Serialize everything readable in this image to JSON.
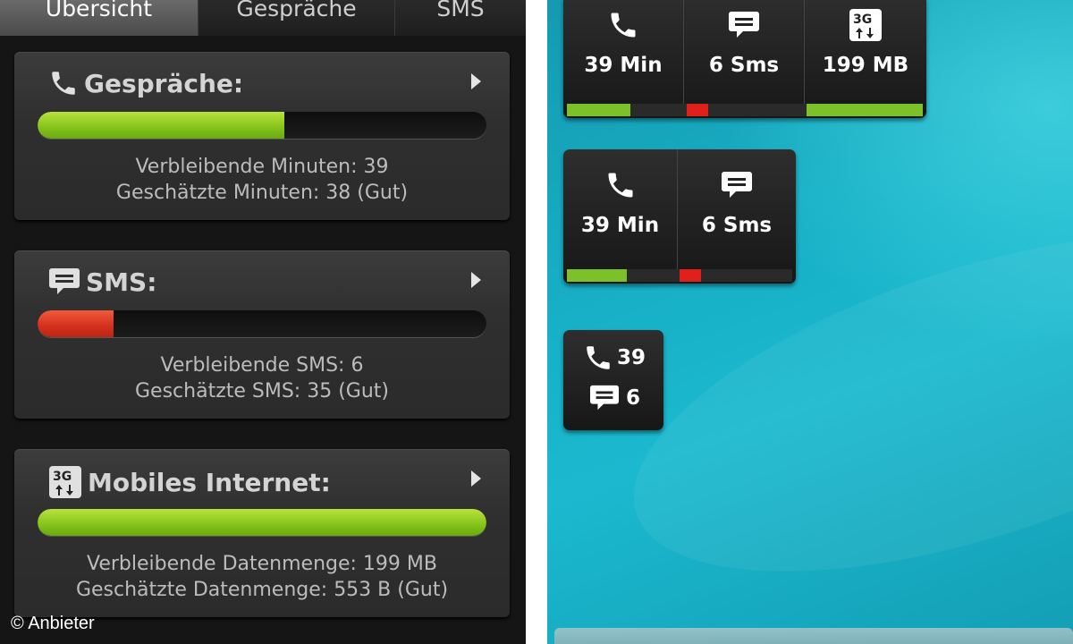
{
  "tabs": [
    {
      "label": "Übersicht",
      "active": true
    },
    {
      "label": "Gespräche",
      "active": false
    },
    {
      "label": "SMS",
      "active": false
    }
  ],
  "cards": {
    "calls": {
      "title": "Gespräche:",
      "icon": "phone-icon",
      "progress": 0.55,
      "color": "#84c21a",
      "line1": "Verbleibende Minuten: 39",
      "line2": "Geschätzte Minuten: 38 (Gut)"
    },
    "sms": {
      "title": "SMS:",
      "icon": "sms-bubble-icon",
      "progress": 0.17,
      "color": "#d3301c",
      "line1": "Verbleibende SMS: 6",
      "line2": "Geschätzte SMS: 35 (Gut)"
    },
    "internet": {
      "title": "Mobiles Internet:",
      "icon": "3g-data-icon",
      "progress": 1.0,
      "color": "#84c21a",
      "line1": "Verbleibende Datenmenge: 199 MB",
      "line2": "Geschätzte Datenmenge: 553 B (Gut)"
    }
  },
  "credit": "© Anbieter",
  "widgets": {
    "large": {
      "calls": "39 Min",
      "sms": "6 Sms",
      "data": "199 MB"
    },
    "medium": {
      "calls": "39 Min",
      "sms": "6 Sms"
    },
    "small": {
      "calls": "39",
      "sms": "6"
    }
  },
  "colors": {
    "good": "#7cc02a",
    "warning": "#e0201a",
    "background": "#1bb9cf"
  }
}
